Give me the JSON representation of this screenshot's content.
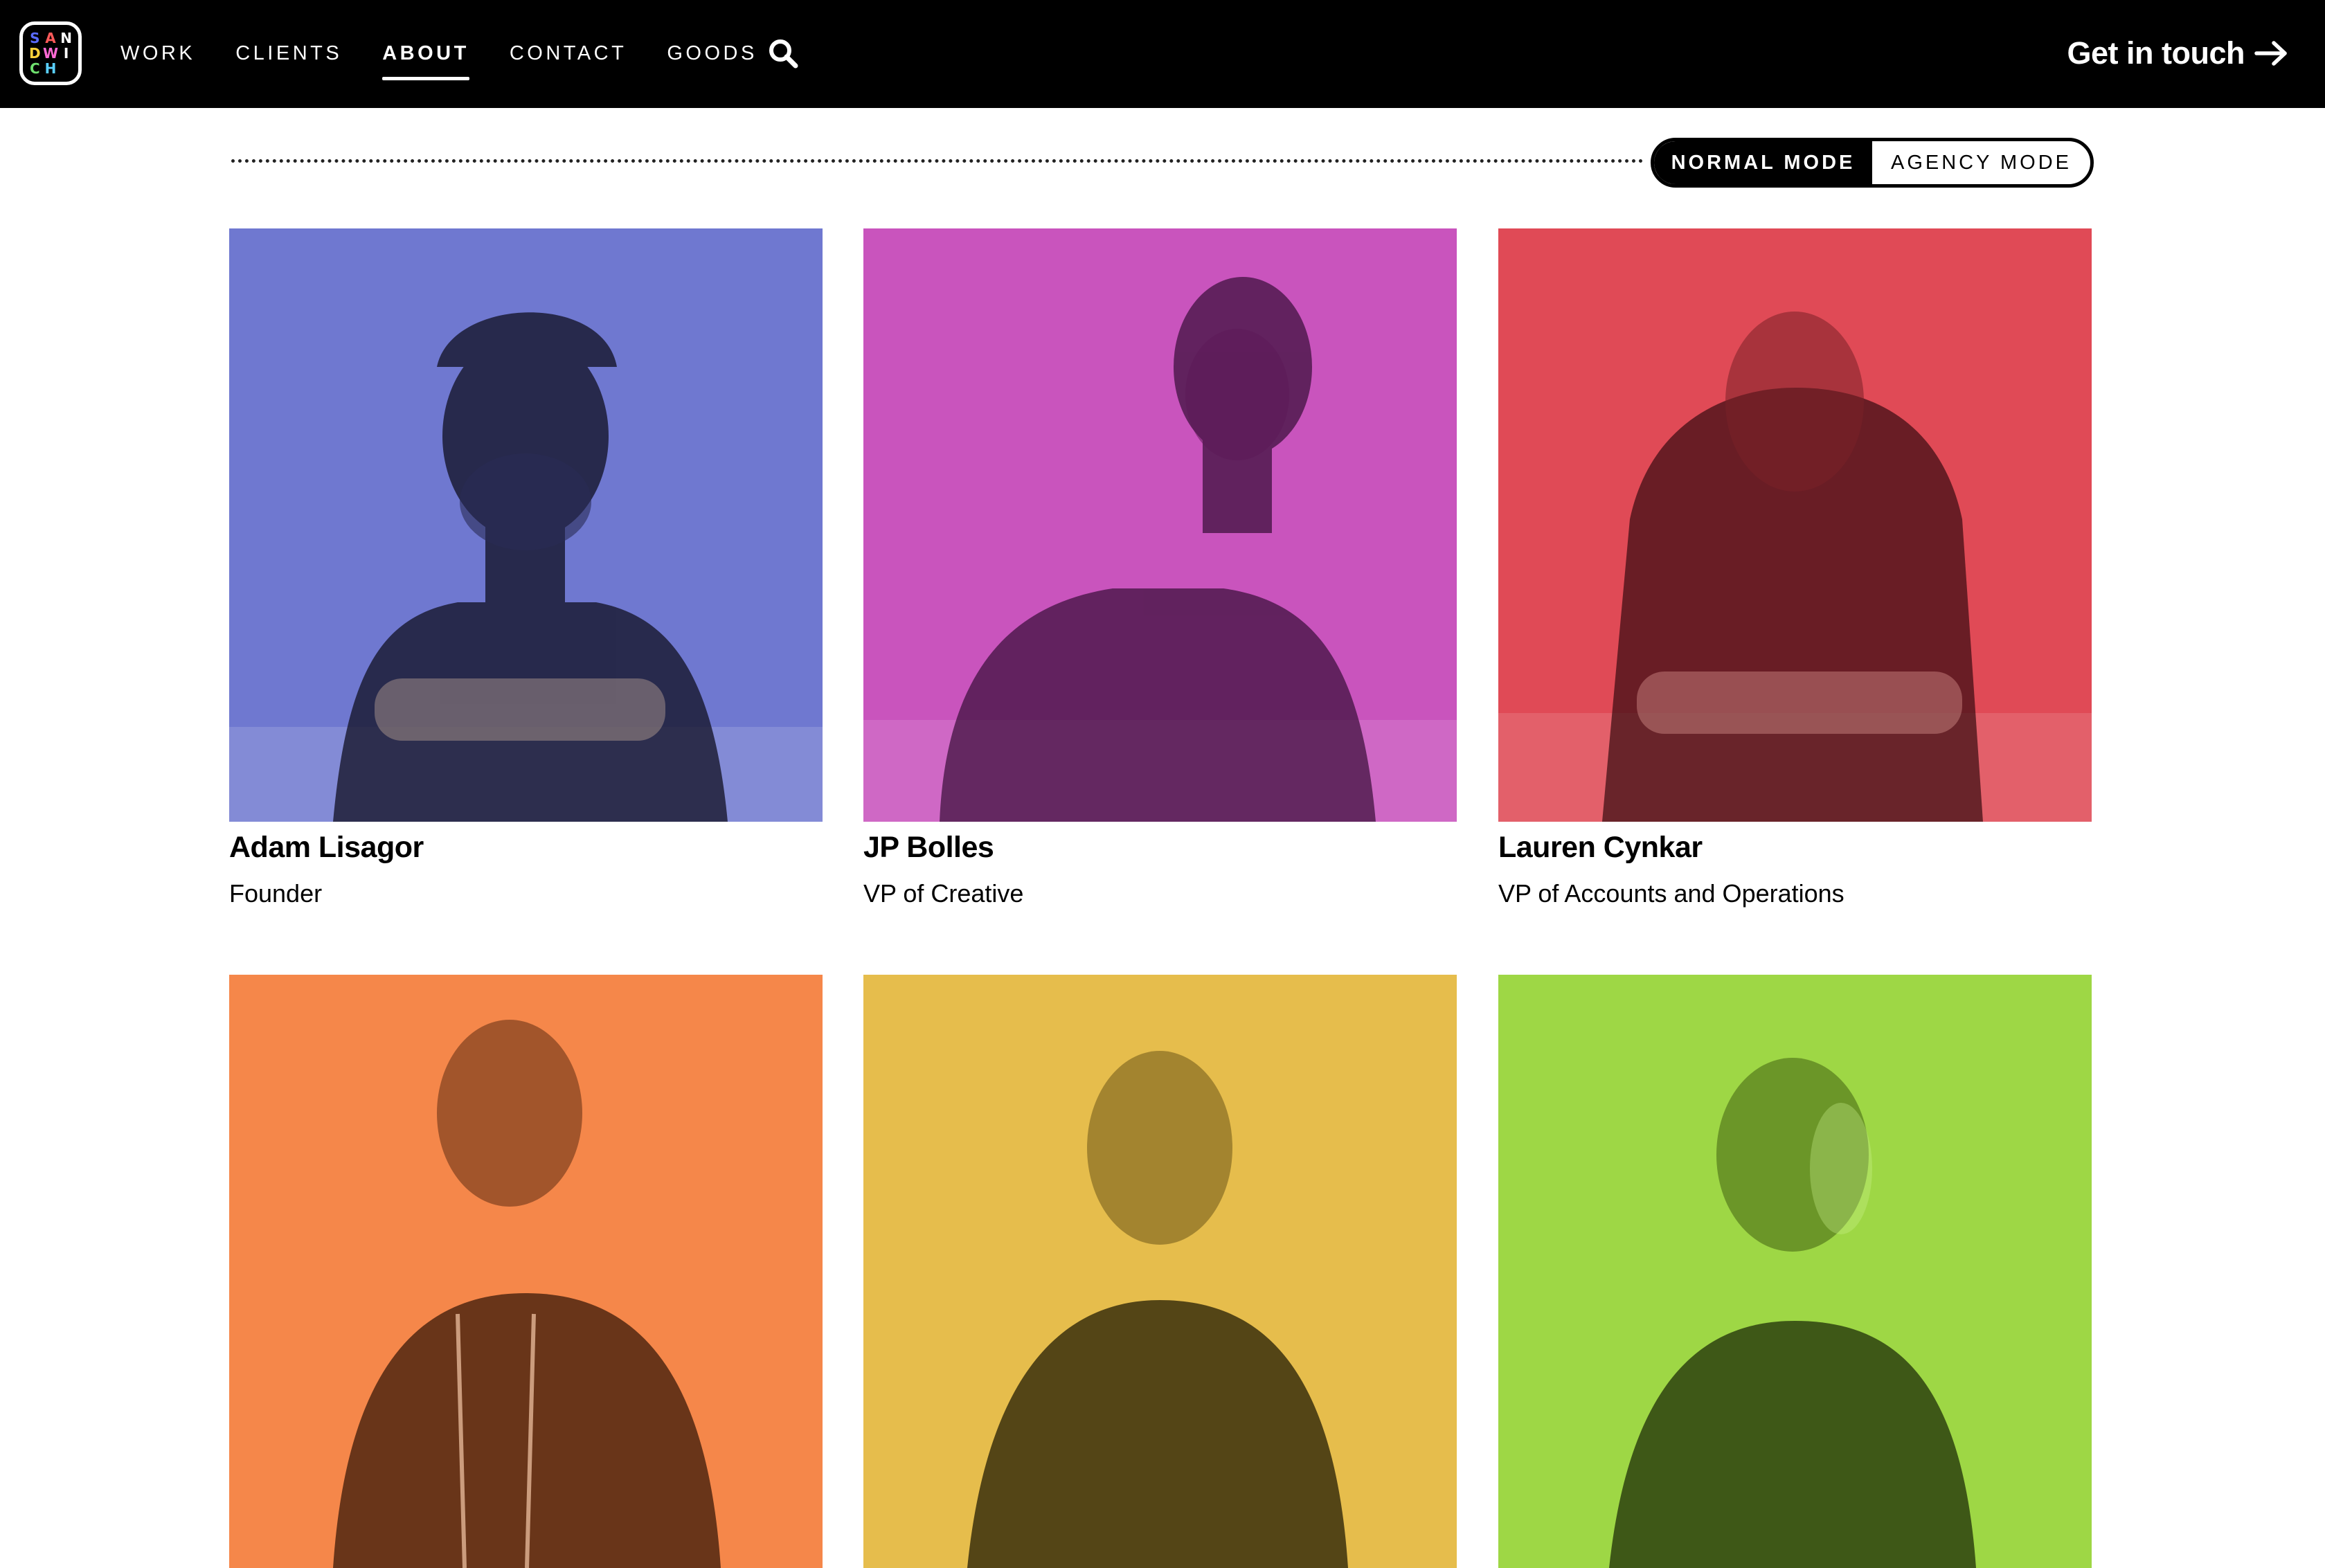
{
  "brand": {
    "logo_letters": [
      "S",
      "A",
      "N",
      "D",
      "W",
      "I",
      "C",
      "H"
    ],
    "logo_colors": [
      "#5a6bff",
      "#ff5a5a",
      "#ffffff",
      "#ffd23a",
      "#ff6ad5",
      "#ffffff",
      "#6ee06e",
      "#5ad0ff"
    ]
  },
  "nav": {
    "items": [
      {
        "label": "WORK"
      },
      {
        "label": "CLIENTS"
      },
      {
        "label": "ABOUT"
      },
      {
        "label": "CONTACT"
      },
      {
        "label": "GOODS"
      }
    ],
    "active": "ABOUT",
    "search_icon": "search-icon"
  },
  "cta": {
    "label": "Get in touch",
    "icon": "arrow-right-icon"
  },
  "mode_toggle": {
    "options": [
      "NORMAL MODE",
      "AGENCY MODE"
    ],
    "selected": "NORMAL MODE"
  },
  "team": [
    {
      "name": "Adam Lisagor",
      "role": "Founder",
      "color": "#6f78d0"
    },
    {
      "name": "JP Bolles",
      "role": "VP of Creative",
      "color": "#c954bd"
    },
    {
      "name": "Lauren Cynkar",
      "role": "VP of Accounts and Operations",
      "color": "#e04a56"
    },
    {
      "name": "",
      "role": "",
      "color": "#f5874a"
    },
    {
      "name": "",
      "role": "",
      "color": "#e6bd4c"
    },
    {
      "name": "",
      "role": "",
      "color": "#9ed745"
    }
  ]
}
